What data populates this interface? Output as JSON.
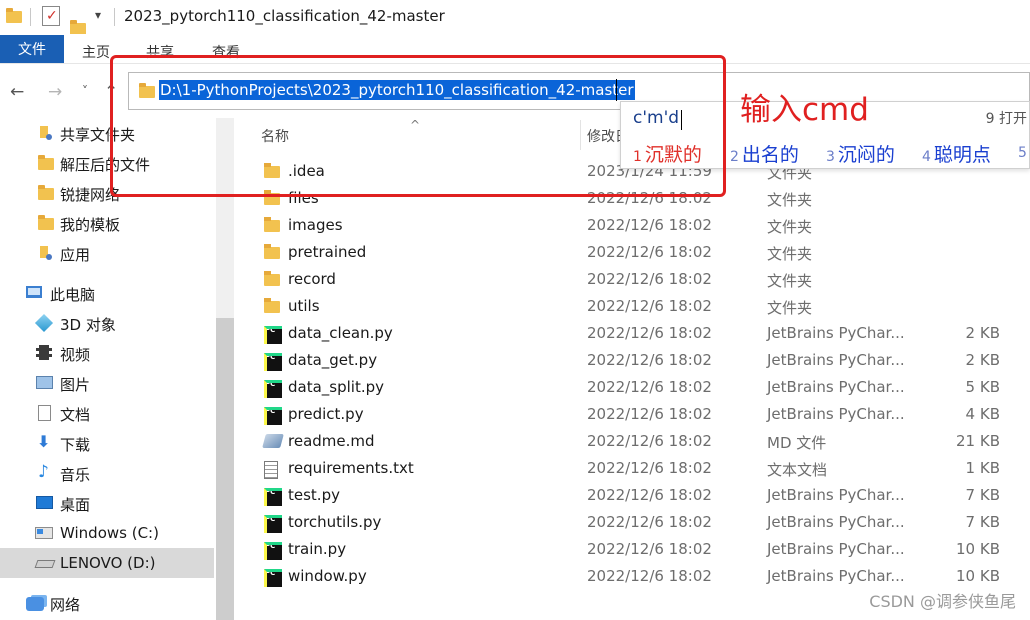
{
  "window": {
    "title": "2023_pytorch110_classification_42-master"
  },
  "ribbon": {
    "tabs": [
      "文件",
      "主页",
      "共享",
      "查看"
    ]
  },
  "address": {
    "path": "D:\\1-PythonProjects\\2023_pytorch110_classification_42-master"
  },
  "ime": {
    "input": "c'm'd",
    "extra": "9 打开",
    "candidates": [
      {
        "num": "1",
        "text": "沉默的"
      },
      {
        "num": "2",
        "text": "出名的"
      },
      {
        "num": "3",
        "text": "沉闷的"
      },
      {
        "num": "4",
        "text": "聪明点"
      },
      {
        "num": "5",
        "text": ""
      }
    ]
  },
  "annotation": {
    "text": "输入cmd",
    "color": "#e02020"
  },
  "sidebar": {
    "items": [
      {
        "label": "共享文件夹",
        "icon": "pinned-folder-icon"
      },
      {
        "label": "解压后的文件",
        "icon": "folder-icon"
      },
      {
        "label": "锐捷网络",
        "icon": "folder-icon"
      },
      {
        "label": "我的模板",
        "icon": "folder-icon"
      },
      {
        "label": "应用",
        "icon": "pinned-folder-icon"
      },
      {
        "label": "此电脑",
        "icon": "computer-icon"
      },
      {
        "label": "3D 对象",
        "icon": "3d-objects-icon"
      },
      {
        "label": "视频",
        "icon": "video-icon"
      },
      {
        "label": "图片",
        "icon": "pictures-icon"
      },
      {
        "label": "文档",
        "icon": "documents-icon"
      },
      {
        "label": "下载",
        "icon": "downloads-icon"
      },
      {
        "label": "音乐",
        "icon": "music-icon"
      },
      {
        "label": "桌面",
        "icon": "desktop-icon"
      },
      {
        "label": "Windows (C:)",
        "icon": "drive-icon"
      },
      {
        "label": "LENOVO (D:)",
        "icon": "drive-icon"
      },
      {
        "label": "网络",
        "icon": "network-icon"
      }
    ]
  },
  "columns": {
    "name": "名称",
    "modified": "修改日"
  },
  "files": [
    {
      "name": ".idea",
      "date": "2023/1/24 11:59",
      "type": "文件夹",
      "size": "",
      "kind": "folder"
    },
    {
      "name": "files",
      "date": "2022/12/6 18:02",
      "type": "文件夹",
      "size": "",
      "kind": "folder"
    },
    {
      "name": "images",
      "date": "2022/12/6 18:02",
      "type": "文件夹",
      "size": "",
      "kind": "folder"
    },
    {
      "name": "pretrained",
      "date": "2022/12/6 18:02",
      "type": "文件夹",
      "size": "",
      "kind": "folder"
    },
    {
      "name": "record",
      "date": "2022/12/6 18:02",
      "type": "文件夹",
      "size": "",
      "kind": "folder"
    },
    {
      "name": "utils",
      "date": "2022/12/6 18:02",
      "type": "文件夹",
      "size": "",
      "kind": "folder"
    },
    {
      "name": "data_clean.py",
      "date": "2022/12/6 18:02",
      "type": "JetBrains PyChar...",
      "size": "2 KB",
      "kind": "py"
    },
    {
      "name": "data_get.py",
      "date": "2022/12/6 18:02",
      "type": "JetBrains PyChar...",
      "size": "2 KB",
      "kind": "py"
    },
    {
      "name": "data_split.py",
      "date": "2022/12/6 18:02",
      "type": "JetBrains PyChar...",
      "size": "5 KB",
      "kind": "py"
    },
    {
      "name": "predict.py",
      "date": "2022/12/6 18:02",
      "type": "JetBrains PyChar...",
      "size": "4 KB",
      "kind": "py"
    },
    {
      "name": "readme.md",
      "date": "2022/12/6 18:02",
      "type": "MD 文件",
      "size": "21 KB",
      "kind": "md"
    },
    {
      "name": "requirements.txt",
      "date": "2022/12/6 18:02",
      "type": "文本文档",
      "size": "1 KB",
      "kind": "txt"
    },
    {
      "name": "test.py",
      "date": "2022/12/6 18:02",
      "type": "JetBrains PyChar...",
      "size": "7 KB",
      "kind": "py"
    },
    {
      "name": "torchutils.py",
      "date": "2022/12/6 18:02",
      "type": "JetBrains PyChar...",
      "size": "7 KB",
      "kind": "py"
    },
    {
      "name": "train.py",
      "date": "2022/12/6 18:02",
      "type": "JetBrains PyChar...",
      "size": "10 KB",
      "kind": "py"
    },
    {
      "name": "window.py",
      "date": "2022/12/6 18:02",
      "type": "JetBrains PyChar...",
      "size": "10 KB",
      "kind": "py"
    }
  ],
  "watermark": "CSDN @调参侠鱼尾"
}
